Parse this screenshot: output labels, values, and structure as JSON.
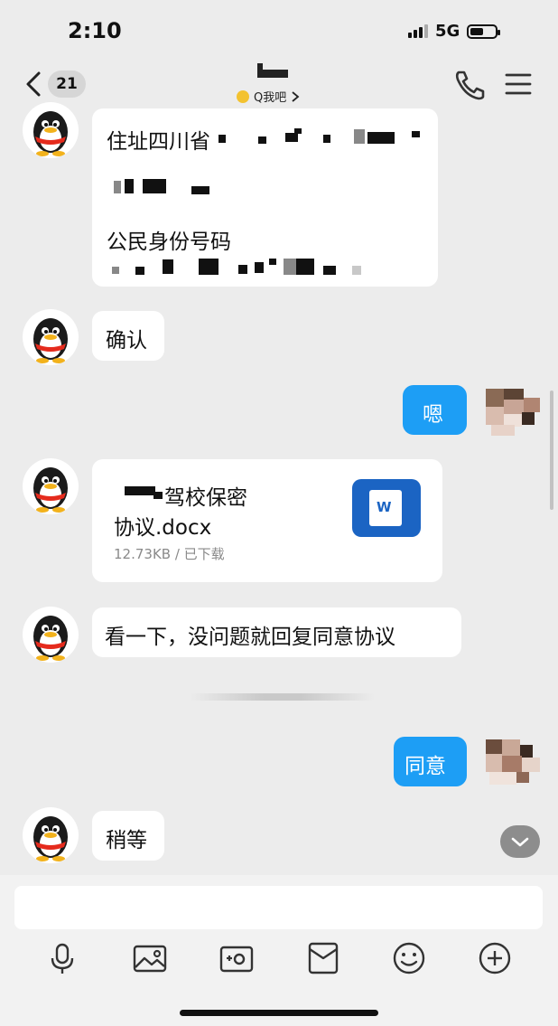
{
  "status_bar": {
    "time": "2:10",
    "network": "5G"
  },
  "header": {
    "unread_count": "21",
    "subtitle": "Q我吧"
  },
  "messages": {
    "m1_line1": "住址四川省",
    "m1_line3": "公民身份号码",
    "m2": "确认",
    "m3": "嗯",
    "file_name_suffix": "驾校保密",
    "file_name_line2": "协议.docx",
    "file_meta": "12.73KB / 已下载",
    "file_icon_letter": "W",
    "m5": "看一下，没问题就回复同意协议",
    "m6": "同意",
    "m7": "稍等"
  },
  "colors": {
    "accent": "#1d9ef5",
    "doc_icon": "#1b64c3",
    "background": "#ececec"
  },
  "toolbar_icons": [
    "microphone-icon",
    "image-icon",
    "camera-icon",
    "red-packet-icon",
    "emoji-icon",
    "plus-icon"
  ]
}
